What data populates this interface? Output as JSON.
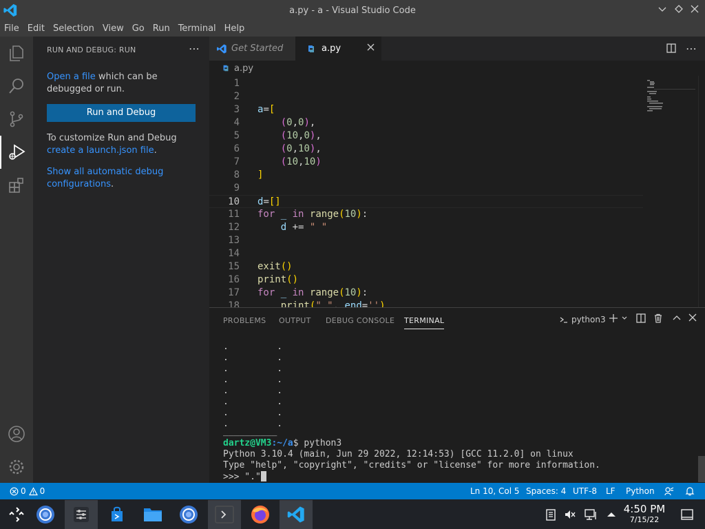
{
  "window": {
    "title": "a.py - a - Visual Studio Code"
  },
  "menu": [
    "File",
    "Edit",
    "Selection",
    "View",
    "Go",
    "Run",
    "Terminal",
    "Help"
  ],
  "sidebar": {
    "title": "RUN AND DEBUG: RUN",
    "open_file_link": "Open a file",
    "open_file_rest": "which can be debugged or run.",
    "run_button": "Run and Debug",
    "customize_text": "To customize Run and Debug",
    "launch_link": "create a launch.json file",
    "launch_rest": ".",
    "show_all_link": "Show all automatic debug configurations",
    "show_all_rest": "."
  },
  "tabs": {
    "get_started": "Get Started",
    "active": "a.py"
  },
  "breadcrumb": "a.py",
  "editor": {
    "current_line": 10,
    "line_numbers": [
      "1",
      "2",
      "3",
      "4",
      "5",
      "6",
      "7",
      "8",
      "9",
      "10",
      "11",
      "12",
      "13",
      "14",
      "15",
      "16",
      "17",
      "18"
    ]
  },
  "panel": {
    "tabs": [
      "PROBLEMS",
      "OUTPUT",
      "DEBUG CONSOLE",
      "TERMINAL"
    ],
    "active_tab": "TERMINAL",
    "terminal_name": "python3",
    "dots": ".         .",
    "separator": "__________",
    "prompt_user": "dartz@VM3",
    "prompt_path": ":~/a",
    "prompt_cmd": "$ python3",
    "python_version": "Python 3.10.4 (main, Jun 29 2022, 12:14:53) [GCC 11.2.0] on linux",
    "python_help": "Type \"help\", \"copyright\", \"credits\" or \"license\" for more information.",
    "repl_input": ">>> \".\""
  },
  "status": {
    "errors": "0",
    "warnings": "0",
    "position": "Ln 10, Col 5",
    "spaces": "Spaces: 4",
    "encoding": "UTF-8",
    "eol": "LF",
    "language": "Python"
  },
  "taskbar": {
    "time": "4:50 PM",
    "date": "7/15/22"
  },
  "colors": {
    "accent": "#007acc",
    "button": "#0e639c",
    "link": "#3794ff"
  }
}
